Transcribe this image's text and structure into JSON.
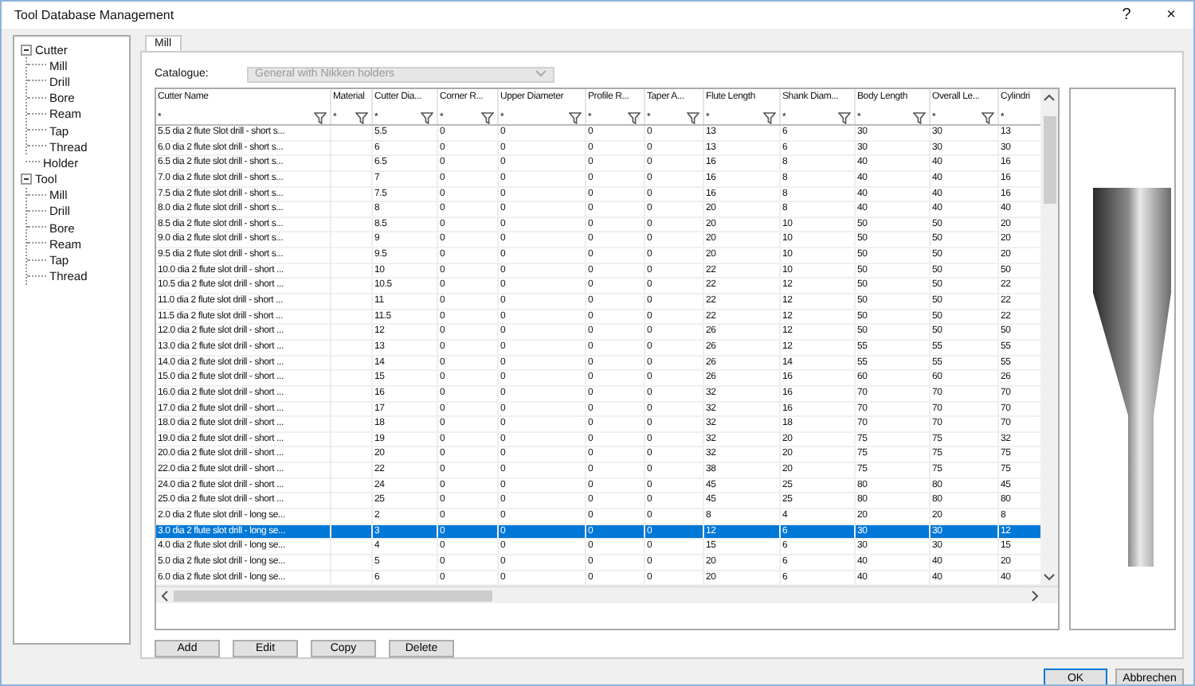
{
  "window": {
    "title": "Tool Database Management",
    "help": "?",
    "close": "×"
  },
  "tree": [
    {
      "label": "Cutter",
      "expanded": true,
      "children": [
        {
          "label": "Mill"
        },
        {
          "label": "Drill"
        },
        {
          "label": "Bore"
        },
        {
          "label": "Ream"
        },
        {
          "label": "Tap"
        },
        {
          "label": "Thread"
        }
      ]
    },
    {
      "label": "Holder"
    },
    {
      "label": "Tool",
      "expanded": true,
      "children": [
        {
          "label": "Mill"
        },
        {
          "label": "Drill"
        },
        {
          "label": "Bore"
        },
        {
          "label": "Ream"
        },
        {
          "label": "Tap"
        },
        {
          "label": "Thread"
        }
      ]
    }
  ],
  "tabs": [
    {
      "label": "Mill",
      "selected": true
    }
  ],
  "catalogue": {
    "label": "Catalogue:",
    "value": "General with Nikken holders",
    "disabled": true
  },
  "table": {
    "columns": [
      {
        "label": "Cutter Name",
        "filter": "*"
      },
      {
        "label": "Material",
        "filter": "*"
      },
      {
        "label": "Cutter Dia...",
        "filter": "*"
      },
      {
        "label": "Corner R...",
        "filter": "*"
      },
      {
        "label": "Upper Diameter",
        "filter": "*"
      },
      {
        "label": "Profile R...",
        "filter": "*"
      },
      {
        "label": "Taper A...",
        "filter": "*"
      },
      {
        "label": "Flute Length",
        "filter": "*"
      },
      {
        "label": "Shank Diam...",
        "filter": "*"
      },
      {
        "label": "Body Length",
        "filter": "*"
      },
      {
        "label": "Overall Le...",
        "filter": "*"
      },
      {
        "label": "Cylindri",
        "filter": "*"
      }
    ],
    "rows": [
      {
        "selected": false,
        "cells": [
          "5.5 dia 2 flute Slot drill - short s...",
          null,
          "5.5",
          "0",
          "0",
          "0",
          "0",
          "13",
          "6",
          "30",
          "30",
          "13"
        ]
      },
      {
        "selected": false,
        "cells": [
          "6.0 dia 2 flute slot drill - short s...",
          null,
          "6",
          "0",
          "0",
          "0",
          "0",
          "13",
          "6",
          "30",
          "30",
          "30"
        ]
      },
      {
        "selected": false,
        "cells": [
          "6.5 dia 2 flute slot drill - short s...",
          null,
          "6.5",
          "0",
          "0",
          "0",
          "0",
          "16",
          "8",
          "40",
          "40",
          "16"
        ]
      },
      {
        "selected": false,
        "cells": [
          "7.0 dia 2 flute slot drill - short s...",
          null,
          "7",
          "0",
          "0",
          "0",
          "0",
          "16",
          "8",
          "40",
          "40",
          "16"
        ]
      },
      {
        "selected": false,
        "cells": [
          "7.5 dia 2 flute slot drill - short s...",
          null,
          "7.5",
          "0",
          "0",
          "0",
          "0",
          "16",
          "8",
          "40",
          "40",
          "16"
        ]
      },
      {
        "selected": false,
        "cells": [
          "8.0 dia 2 flute slot drill - short s...",
          null,
          "8",
          "0",
          "0",
          "0",
          "0",
          "20",
          "8",
          "40",
          "40",
          "40"
        ]
      },
      {
        "selected": false,
        "cells": [
          "8.5 dia 2 flute slot drill - short s...",
          null,
          "8.5",
          "0",
          "0",
          "0",
          "0",
          "20",
          "10",
          "50",
          "50",
          "20"
        ]
      },
      {
        "selected": false,
        "cells": [
          "9.0 dia 2 flute slot drill - short s...",
          null,
          "9",
          "0",
          "0",
          "0",
          "0",
          "20",
          "10",
          "50",
          "50",
          "20"
        ]
      },
      {
        "selected": false,
        "cells": [
          "9.5 dia 2 flute slot drill - short s...",
          null,
          "9.5",
          "0",
          "0",
          "0",
          "0",
          "20",
          "10",
          "50",
          "50",
          "20"
        ]
      },
      {
        "selected": false,
        "cells": [
          "10.0 dia 2 flute slot drill - short ...",
          null,
          "10",
          "0",
          "0",
          "0",
          "0",
          "22",
          "10",
          "50",
          "50",
          "50"
        ]
      },
      {
        "selected": false,
        "cells": [
          "10.5 dia 2 flute slot drill - short ...",
          null,
          "10.5",
          "0",
          "0",
          "0",
          "0",
          "22",
          "12",
          "50",
          "50",
          "22"
        ]
      },
      {
        "selected": false,
        "cells": [
          "11.0 dia 2 flute slot drill - short ...",
          null,
          "11",
          "0",
          "0",
          "0",
          "0",
          "22",
          "12",
          "50",
          "50",
          "22"
        ]
      },
      {
        "selected": false,
        "cells": [
          "11.5 dia 2 flute slot drill - short ...",
          null,
          "11.5",
          "0",
          "0",
          "0",
          "0",
          "22",
          "12",
          "50",
          "50",
          "22"
        ]
      },
      {
        "selected": false,
        "cells": [
          "12.0 dia 2 flute slot drill - short ...",
          null,
          "12",
          "0",
          "0",
          "0",
          "0",
          "26",
          "12",
          "50",
          "50",
          "50"
        ]
      },
      {
        "selected": false,
        "cells": [
          "13.0 dia 2 flute slot drill - short ...",
          null,
          "13",
          "0",
          "0",
          "0",
          "0",
          "26",
          "12",
          "55",
          "55",
          "55"
        ]
      },
      {
        "selected": false,
        "cells": [
          "14.0 dia 2 flute slot drill - short ...",
          null,
          "14",
          "0",
          "0",
          "0",
          "0",
          "26",
          "14",
          "55",
          "55",
          "55"
        ]
      },
      {
        "selected": false,
        "cells": [
          "15.0 dia 2 flute slot drill - short ...",
          null,
          "15",
          "0",
          "0",
          "0",
          "0",
          "26",
          "16",
          "60",
          "60",
          "26"
        ]
      },
      {
        "selected": false,
        "cells": [
          "16.0 dia 2 flute slot drill - short ...",
          null,
          "16",
          "0",
          "0",
          "0",
          "0",
          "32",
          "16",
          "70",
          "70",
          "70"
        ]
      },
      {
        "selected": false,
        "cells": [
          "17.0 dia 2 flute slot drill - short ...",
          null,
          "17",
          "0",
          "0",
          "0",
          "0",
          "32",
          "16",
          "70",
          "70",
          "70"
        ]
      },
      {
        "selected": false,
        "cells": [
          "18.0 dia 2 flute slot drill - short ...",
          null,
          "18",
          "0",
          "0",
          "0",
          "0",
          "32",
          "18",
          "70",
          "70",
          "70"
        ]
      },
      {
        "selected": false,
        "cells": [
          "19.0 dia 2 flute slot drill - short ...",
          null,
          "19",
          "0",
          "0",
          "0",
          "0",
          "32",
          "20",
          "75",
          "75",
          "32"
        ]
      },
      {
        "selected": false,
        "cells": [
          "20.0 dia 2 flute slot drill - short ...",
          null,
          "20",
          "0",
          "0",
          "0",
          "0",
          "32",
          "20",
          "75",
          "75",
          "75"
        ]
      },
      {
        "selected": false,
        "cells": [
          "22.0 dia 2 flute slot drill - short ...",
          null,
          "22",
          "0",
          "0",
          "0",
          "0",
          "38",
          "20",
          "75",
          "75",
          "75"
        ]
      },
      {
        "selected": false,
        "cells": [
          "24.0 dia 2 flute slot drill - short ...",
          null,
          "24",
          "0",
          "0",
          "0",
          "0",
          "45",
          "25",
          "80",
          "80",
          "45"
        ]
      },
      {
        "selected": false,
        "cells": [
          "25.0 dia 2 flute slot drill - short ...",
          null,
          "25",
          "0",
          "0",
          "0",
          "0",
          "45",
          "25",
          "80",
          "80",
          "80"
        ]
      },
      {
        "selected": false,
        "cells": [
          "2.0 dia 2 flute slot drill - long se...",
          null,
          "2",
          "0",
          "0",
          "0",
          "0",
          "8",
          "4",
          "20",
          "20",
          "8"
        ]
      },
      {
        "selected": true,
        "cells": [
          "3.0 dia 2 flute slot drill - long se...",
          null,
          "3",
          "0",
          "0",
          "0",
          "0",
          "12",
          "6",
          "30",
          "30",
          "12"
        ]
      },
      {
        "selected": false,
        "cells": [
          "4.0 dia 2 flute slot drill - long se...",
          null,
          "4",
          "0",
          "0",
          "0",
          "0",
          "15",
          "6",
          "30",
          "30",
          "15"
        ]
      },
      {
        "selected": false,
        "cells": [
          "5.0 dia 2 flute slot drill - long se...",
          null,
          "5",
          "0",
          "0",
          "0",
          "0",
          "20",
          "6",
          "40",
          "40",
          "20"
        ]
      },
      {
        "selected": false,
        "cells": [
          "6.0 dia 2 flute slot drill - long se...",
          null,
          "6",
          "0",
          "0",
          "0",
          "0",
          "20",
          "6",
          "40",
          "40",
          "40"
        ]
      }
    ]
  },
  "actions": [
    "Add",
    "Edit",
    "Copy",
    "Delete"
  ],
  "buttons": [
    {
      "label": "OK",
      "kind": "default"
    },
    {
      "label": "Abbrechen",
      "kind": "normal"
    }
  ]
}
